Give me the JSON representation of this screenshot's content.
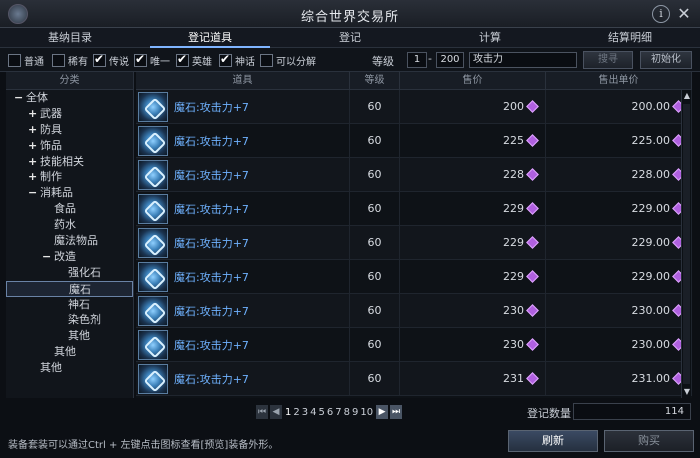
{
  "window": {
    "title": "综合世界交易所"
  },
  "tabs": [
    {
      "label": "基纳目录",
      "active": false
    },
    {
      "label": "登记道具",
      "active": true
    },
    {
      "label": "登记",
      "active": false
    },
    {
      "label": "计算",
      "active": false
    },
    {
      "label": "结算明细",
      "active": false
    }
  ],
  "filters": {
    "checkboxes": [
      {
        "label": "普通",
        "checked": false
      },
      {
        "label": "稀有",
        "checked": false
      },
      {
        "label": "传说",
        "checked": true
      },
      {
        "label": "唯一",
        "checked": true
      },
      {
        "label": "英雄",
        "checked": true
      },
      {
        "label": "神话",
        "checked": true
      },
      {
        "label": "可以分解",
        "checked": false
      }
    ],
    "level_label": "等级",
    "level_min": "1",
    "level_dash": "-",
    "level_max": "200",
    "search_value": "攻击力",
    "search_button": "搜寻",
    "reset_button": "初始化"
  },
  "sidebar": {
    "header": "分类",
    "items": [
      {
        "toggle": "−",
        "label": "全体",
        "indent": 0
      },
      {
        "toggle": "+",
        "label": "武器",
        "indent": 1
      },
      {
        "toggle": "+",
        "label": "防具",
        "indent": 1
      },
      {
        "toggle": "+",
        "label": "饰品",
        "indent": 1
      },
      {
        "toggle": "+",
        "label": "技能相关",
        "indent": 1
      },
      {
        "toggle": "+",
        "label": "制作",
        "indent": 1
      },
      {
        "toggle": "−",
        "label": "消耗品",
        "indent": 1
      },
      {
        "toggle": "",
        "label": "食品",
        "indent": 2
      },
      {
        "toggle": "",
        "label": "药水",
        "indent": 2
      },
      {
        "toggle": "",
        "label": "魔法物品",
        "indent": 2
      },
      {
        "toggle": "−",
        "label": "改造",
        "indent": 2
      },
      {
        "toggle": "",
        "label": "强化石",
        "indent": 3
      },
      {
        "toggle": "",
        "label": "魔石",
        "indent": 3,
        "selected": true
      },
      {
        "toggle": "",
        "label": "神石",
        "indent": 3
      },
      {
        "toggle": "",
        "label": "染色剂",
        "indent": 3
      },
      {
        "toggle": "",
        "label": "其他",
        "indent": 3
      },
      {
        "toggle": "",
        "label": "其他",
        "indent": 2
      },
      {
        "toggle": "",
        "label": "其他",
        "indent": 1
      }
    ]
  },
  "table": {
    "headers": [
      "道具",
      "等级",
      "售价",
      "售出单价"
    ],
    "rows": [
      {
        "name": "魔石:攻击力+7",
        "level": "60",
        "price": "200",
        "unit_price": "200.00"
      },
      {
        "name": "魔石:攻击力+7",
        "level": "60",
        "price": "225",
        "unit_price": "225.00"
      },
      {
        "name": "魔石:攻击力+7",
        "level": "60",
        "price": "228",
        "unit_price": "228.00"
      },
      {
        "name": "魔石:攻击力+7",
        "level": "60",
        "price": "229",
        "unit_price": "229.00"
      },
      {
        "name": "魔石:攻击力+7",
        "level": "60",
        "price": "229",
        "unit_price": "229.00"
      },
      {
        "name": "魔石:攻击力+7",
        "level": "60",
        "price": "229",
        "unit_price": "229.00"
      },
      {
        "name": "魔石:攻击力+7",
        "level": "60",
        "price": "230",
        "unit_price": "230.00"
      },
      {
        "name": "魔石:攻击力+7",
        "level": "60",
        "price": "230",
        "unit_price": "230.00"
      },
      {
        "name": "魔石:攻击力+7",
        "level": "60",
        "price": "231",
        "unit_price": "231.00"
      }
    ]
  },
  "pager": {
    "pages": [
      "1",
      "2",
      "3",
      "4",
      "5",
      "6",
      "7",
      "8",
      "9",
      "10"
    ],
    "current": "1"
  },
  "footer": {
    "count_label": "登记数量",
    "count_value": "114",
    "hint": "装备套装可以通过Ctrl + 左键点击图标查看[预览]装备外形。",
    "refresh_button": "刷新",
    "buy_button": "购买"
  },
  "colors": {
    "accent": "#7fb4ff",
    "item_name": "#6fb2ff",
    "currency_gem": "#b060e0"
  },
  "icons": {
    "item": "odian-stone-icon",
    "currency": "kinah-gem-icon"
  }
}
